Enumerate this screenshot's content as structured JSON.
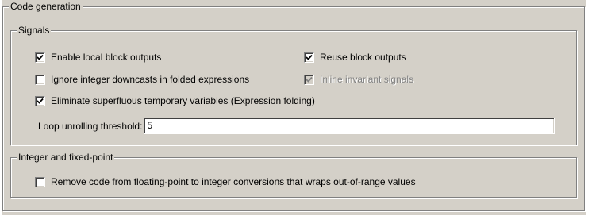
{
  "code_generation": {
    "title": "Code generation",
    "signals": {
      "title": "Signals",
      "enable_local_block_outputs": {
        "label": "Enable local block outputs",
        "checked": true,
        "enabled": true
      },
      "reuse_block_outputs": {
        "label": "Reuse block outputs",
        "checked": true,
        "enabled": true
      },
      "ignore_integer_downcasts": {
        "label": "Ignore integer downcasts in folded expressions",
        "checked": false,
        "enabled": true
      },
      "inline_invariant_signals": {
        "label": "Inline invariant signals",
        "checked": true,
        "enabled": false
      },
      "eliminate_superfluous_temp_vars": {
        "label": "Eliminate superfluous temporary variables (Expression folding)",
        "checked": true,
        "enabled": true
      },
      "loop_unrolling_threshold": {
        "label": "Loop unrolling threshold:",
        "value": "5"
      }
    },
    "integer_fixed_point": {
      "title": "Integer and fixed-point",
      "remove_wrap_code": {
        "label": "Remove code from floating-point to integer conversions that wraps out-of-range values",
        "checked": false,
        "enabled": true
      }
    }
  },
  "colors": {
    "panel_background": "#d4d0c8",
    "disabled_text": "#808080"
  }
}
